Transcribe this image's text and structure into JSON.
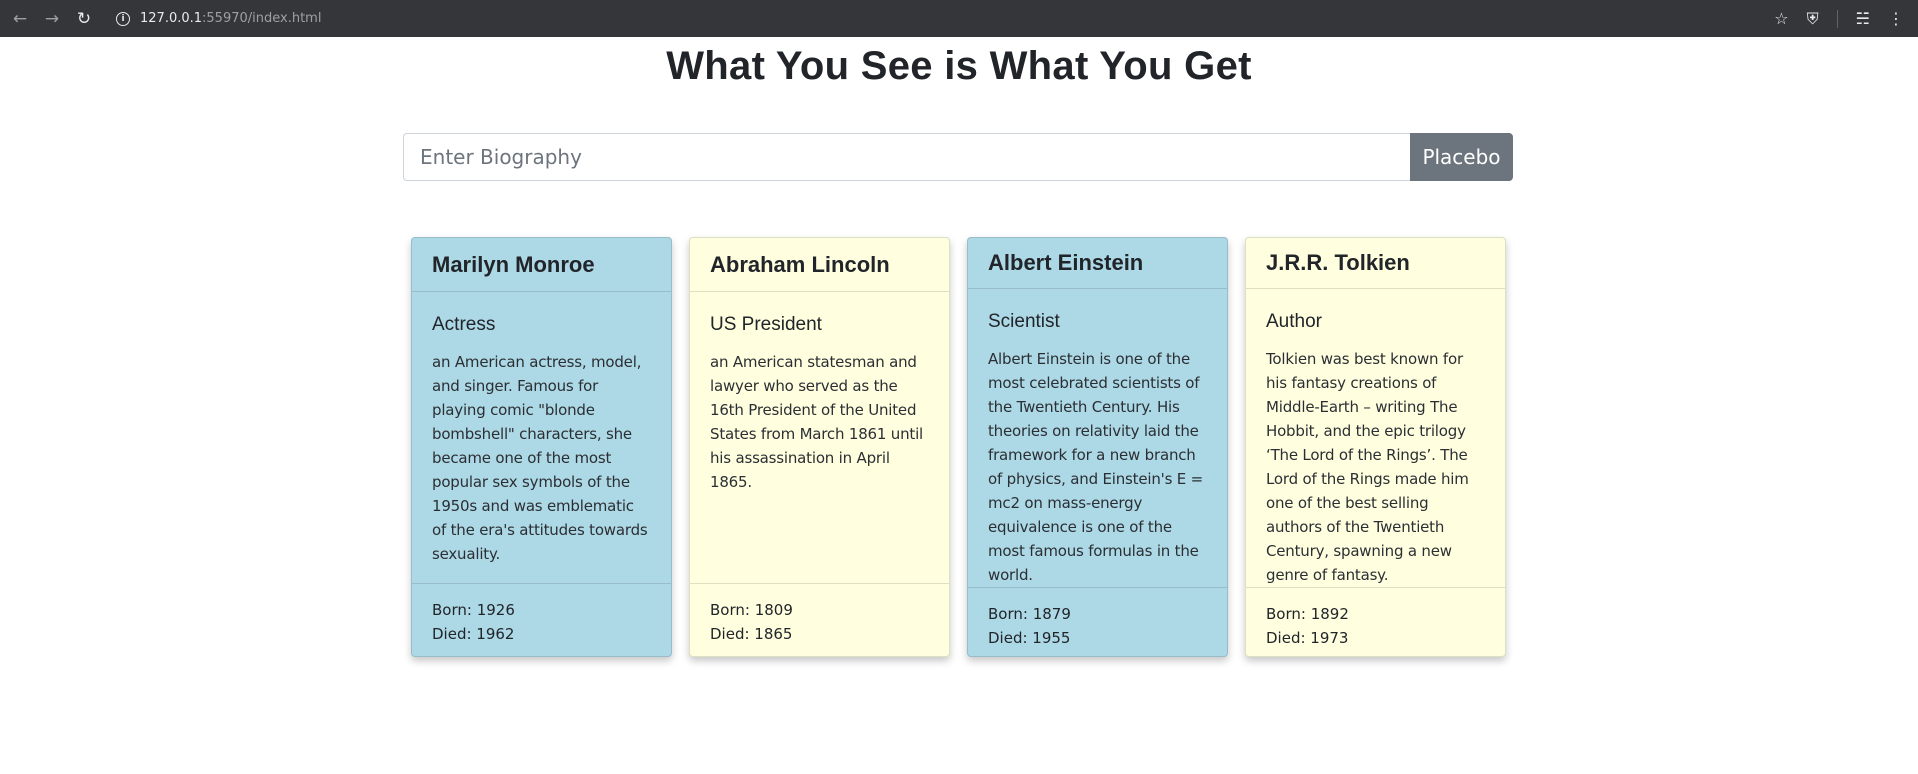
{
  "browser": {
    "url_host": "127.0.0.1",
    "url_rest": ":55970/index.html"
  },
  "page": {
    "title": "What You See is What You Get"
  },
  "search": {
    "placeholder": "Enter Biography",
    "button_label": "Placebo",
    "button_color": "#6c757d"
  },
  "colors": {
    "card_blue": "#add8e6",
    "card_yellow": "#ffffe0"
  },
  "cards": [
    {
      "name": "Marilyn Monroe",
      "role": "Actress",
      "bio": "an American actress, model, and singer. Famous for playing comic \"blonde bombshell\" characters, she became one of the most popular sex symbols of the 1950s and was emblematic of the era's attitudes towards sexuality.",
      "born": "Born: 1926",
      "died": "Died: 1962",
      "color": "blue"
    },
    {
      "name": "Abraham Lincoln",
      "role": "US President",
      "bio": "an American statesman and lawyer who served as the 16th President of the United States from March 1861 until his assassination in April 1865.",
      "born": "Born: 1809",
      "died": "Died: 1865",
      "color": "yellow"
    },
    {
      "name": "Albert Einstein",
      "role": "Scientist",
      "bio": "Albert Einstein is one of the most celebrated scientists of the Twentieth Century. His theories on relativity laid the framework for a new branch of physics, and Einstein's E = mc2 on mass-energy equivalence is one of the most famous formulas in the world.",
      "born": "Born: 1879",
      "died": "Died: 1955",
      "color": "blue"
    },
    {
      "name": "J.R.R. Tolkien",
      "role": "Author",
      "bio": "Tolkien was best known for his fantasy creations of Middle-Earth – writing The Hobbit, and the epic trilogy ‘The Lord of the Rings’. The Lord of the Rings made him one of the best selling authors of the Twentieth Century, spawning a new genre of fantasy.",
      "born": "Born: 1892",
      "died": "Died: 1973",
      "color": "yellow"
    }
  ]
}
